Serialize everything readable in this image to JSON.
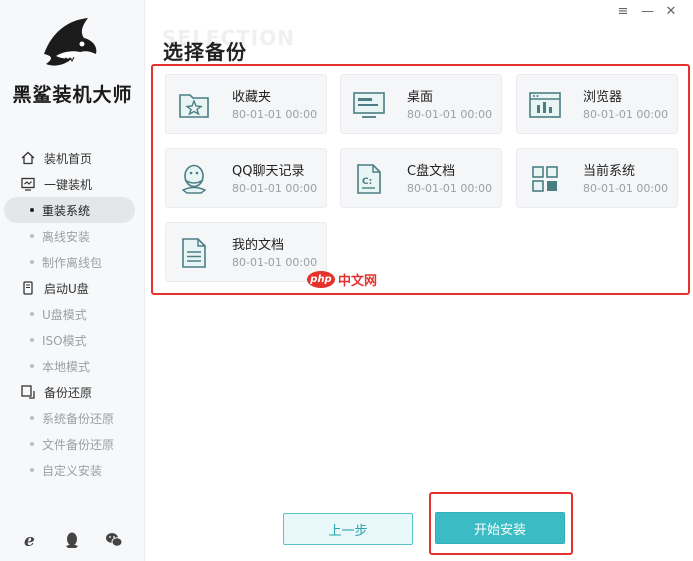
{
  "app": {
    "title": "黑鲨装机大师"
  },
  "window_controls": {
    "menu": "≡",
    "minimize": "—",
    "close": "✕"
  },
  "sidebar": {
    "groups": [
      {
        "label": "装机首页",
        "icon": "home-icon",
        "items": []
      },
      {
        "label": "一键装机",
        "icon": "monitor-icon",
        "items": [
          {
            "label": "重装系统",
            "active": true
          },
          {
            "label": "离线安装",
            "active": false
          },
          {
            "label": "制作离线包",
            "active": false
          }
        ]
      },
      {
        "label": "启动U盘",
        "icon": "usb-icon",
        "items": [
          {
            "label": "U盘模式",
            "active": false
          },
          {
            "label": "ISO模式",
            "active": false
          },
          {
            "label": "本地模式",
            "active": false
          }
        ]
      },
      {
        "label": "备份还原",
        "icon": "backup-icon",
        "items": [
          {
            "label": "系统备份还原",
            "active": false
          },
          {
            "label": "文件备份还原",
            "active": false
          },
          {
            "label": "自定义安装",
            "active": false
          }
        ]
      }
    ],
    "footer_icons": [
      "ie-icon",
      "qq-icon",
      "wechat-icon"
    ]
  },
  "main": {
    "title": "选择备份",
    "watermark": "SELECTION",
    "cards": [
      {
        "name": "收藏夹",
        "date": "80-01-01 00:00",
        "icon": "favorites-folder-icon"
      },
      {
        "name": "桌面",
        "date": "80-01-01 00:00",
        "icon": "desktop-icon"
      },
      {
        "name": "浏览器",
        "date": "80-01-01 00:00",
        "icon": "browser-icon"
      },
      {
        "name": "QQ聊天记录",
        "date": "80-01-01 00:00",
        "icon": "qq-icon"
      },
      {
        "name": "C盘文档",
        "date": "80-01-01 00:00",
        "icon": "c-drive-doc-icon"
      },
      {
        "name": "当前系统",
        "date": "80-01-01 00:00",
        "icon": "system-grid-icon"
      },
      {
        "name": "我的文档",
        "date": "80-01-01 00:00",
        "icon": "document-icon"
      }
    ],
    "buttons": {
      "prev": "上一步",
      "start": "开始安装"
    }
  },
  "overlay": {
    "php_logo": "php",
    "php_site": "中文网"
  },
  "colors": {
    "accent": "#3bbcc4",
    "highlight_frame": "#e5322d"
  }
}
